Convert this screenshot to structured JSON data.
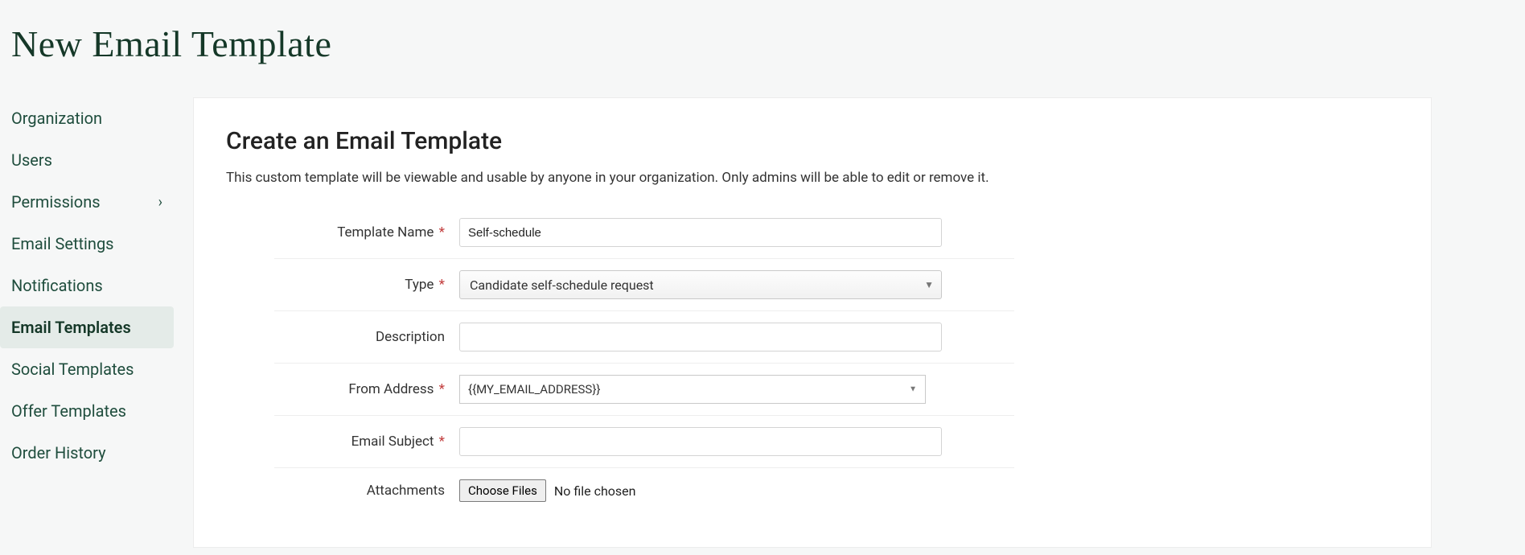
{
  "page": {
    "title": "New Email Template"
  },
  "sidebar": {
    "items": [
      {
        "label": "Organization",
        "has_children": false,
        "active": false
      },
      {
        "label": "Users",
        "has_children": false,
        "active": false
      },
      {
        "label": "Permissions",
        "has_children": true,
        "active": false
      },
      {
        "label": "Email Settings",
        "has_children": false,
        "active": false
      },
      {
        "label": "Notifications",
        "has_children": false,
        "active": false
      },
      {
        "label": "Email Templates",
        "has_children": false,
        "active": true
      },
      {
        "label": "Social Templates",
        "has_children": false,
        "active": false
      },
      {
        "label": "Offer Templates",
        "has_children": false,
        "active": false
      },
      {
        "label": "Order History",
        "has_children": false,
        "active": false
      }
    ]
  },
  "panel": {
    "heading": "Create an Email Template",
    "description": "This custom template will be viewable and usable by anyone in your organization. Only admins will be able to edit or remove it."
  },
  "form": {
    "template_name": {
      "label": "Template Name",
      "required": true,
      "value": "Self-schedule"
    },
    "type": {
      "label": "Type",
      "required": true,
      "value": "Candidate self-schedule request"
    },
    "description": {
      "label": "Description",
      "required": false,
      "value": ""
    },
    "from_address": {
      "label": "From Address",
      "required": true,
      "value": "{{MY_EMAIL_ADDRESS}}"
    },
    "email_subject": {
      "label": "Email Subject",
      "required": true,
      "value": ""
    },
    "attachments": {
      "label": "Attachments",
      "button": "Choose Files",
      "status": "No file chosen"
    }
  }
}
